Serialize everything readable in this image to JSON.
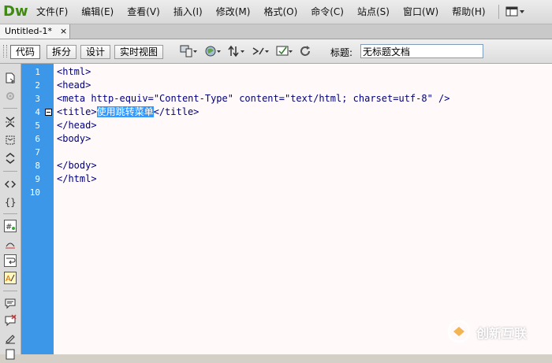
{
  "app": {
    "logo_text": "Dw",
    "menu": [
      "文件(F)",
      "编辑(E)",
      "查看(V)",
      "插入(I)",
      "修改(M)",
      "格式(O)",
      "命令(C)",
      "站点(S)",
      "窗口(W)",
      "帮助(H)"
    ],
    "layout_icon": "layout-switcher-icon"
  },
  "document_tab": {
    "label": "Untitled-1*",
    "close": "×"
  },
  "doc_toolbar": {
    "views": [
      "代码",
      "拆分",
      "设计",
      "实时视图"
    ],
    "active_view": "代码",
    "tools": [
      "multiscreen-icon",
      "preview-globe-icon",
      "file-management-icon",
      "live-code-icon",
      "validate-icon",
      "refresh-icon"
    ],
    "title_label": "标题:",
    "title_value": "无标题文档"
  },
  "code": {
    "line_numbers": [
      "1",
      "2",
      "3",
      "4",
      "5",
      "6",
      "7",
      "8",
      "9",
      "10"
    ],
    "lines": [
      {
        "text": "<html>"
      },
      {
        "text": "<head>"
      },
      {
        "text": "<meta http-equiv=\"Content-Type\" content=\"text/html; charset=utf-8\" />"
      },
      {
        "before": "<title>",
        "selected": "使用跳转菜单",
        "after": "</title>"
      },
      {
        "text": "</head>"
      },
      {
        "text": "<body>"
      },
      {
        "text": ""
      },
      {
        "text": "</body>"
      },
      {
        "text": "</html>"
      },
      {
        "text": ""
      }
    ]
  },
  "colors": {
    "gutter": "#3d97e8",
    "selection": "#3399ff",
    "code_text": "#000080",
    "logo": "#3e8a12"
  },
  "watermark": {
    "text": "创新互联"
  }
}
